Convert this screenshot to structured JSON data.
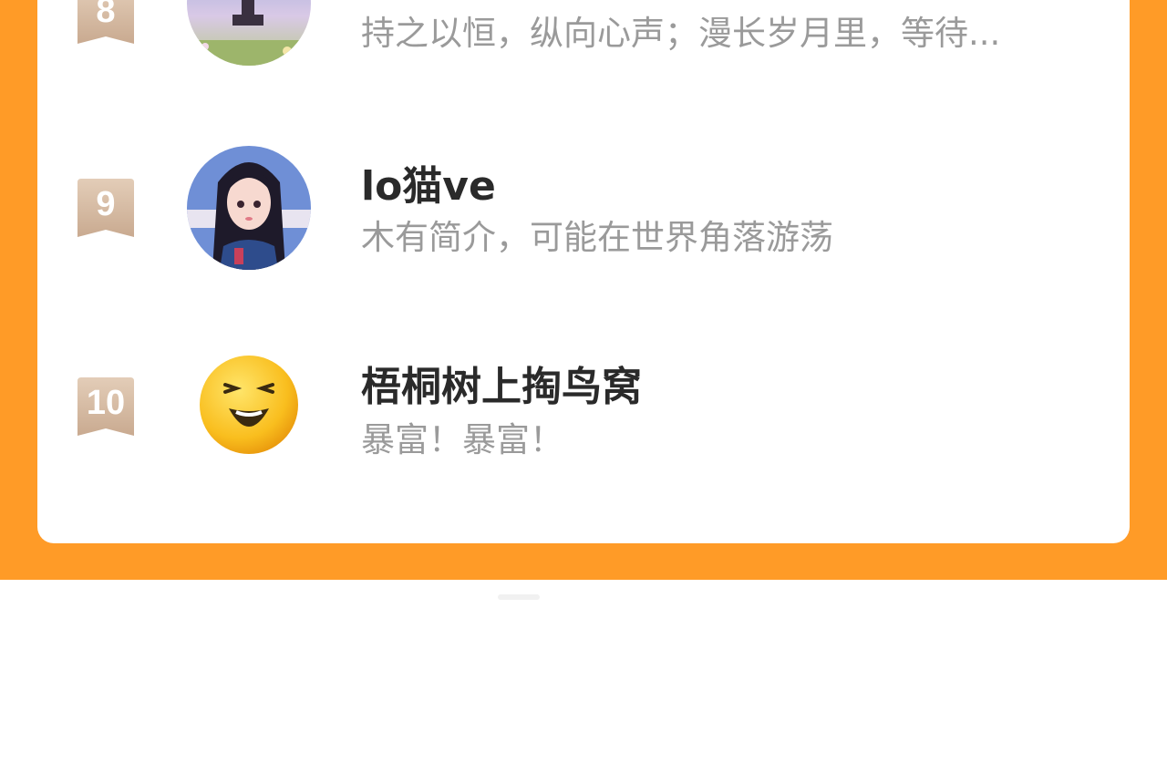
{
  "colors": {
    "page_background": "#FF9B27",
    "card_background": "#FFFFFF",
    "rank_badge": "#D6B9A0",
    "name_text": "#2A2A2A",
    "bio_text": "#9A9A9A",
    "tag_background": "#FFF1B8"
  },
  "ranking": [
    {
      "rank": "8",
      "name": "",
      "bio": "持之以恒，纵向心声；漫长岁月里，等待...",
      "avatar_icon": "anime-girl-sky-avatar-icon"
    },
    {
      "rank": "9",
      "name": "lo猫ve",
      "bio": "木有简介，可能在世界角落游荡",
      "avatar_icon": "anime-girl-portrait-avatar-icon"
    },
    {
      "rank": "10",
      "name": "梧桐树上掏鸟窝",
      "bio": "暴富！暴富！",
      "avatar_icon": "laughing-emoji-avatar-icon"
    }
  ]
}
